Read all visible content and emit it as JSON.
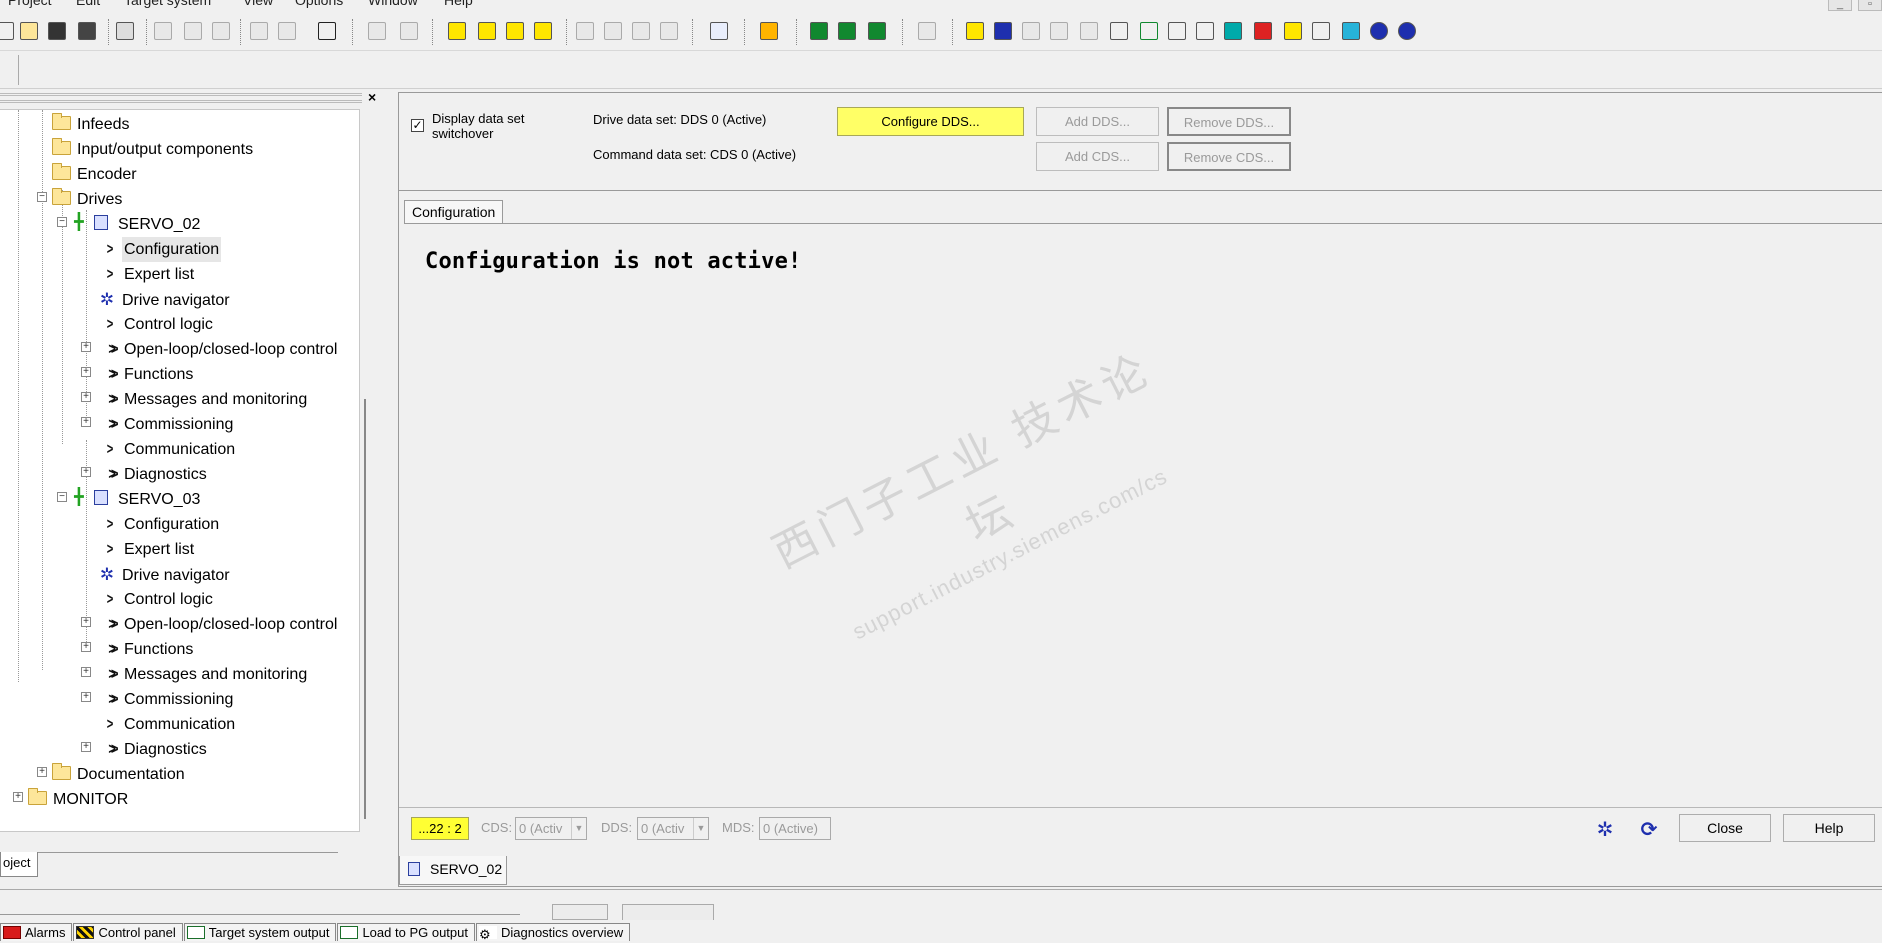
{
  "menu": [
    "Project",
    "Edit",
    "Target system",
    "View",
    "Options",
    "Window",
    "Help"
  ],
  "tree": {
    "nodes": [
      {
        "label": "Infeeds",
        "icon": "folder"
      },
      {
        "label": "Input/output components",
        "icon": "folder"
      },
      {
        "label": "Encoder",
        "icon": "folder"
      },
      {
        "label": "Drives",
        "icon": "folder"
      },
      {
        "label": "SERVO_02",
        "icon": "drive"
      },
      {
        "label": "Configuration",
        "icon": "chevron"
      },
      {
        "label": "Expert list",
        "icon": "chevron"
      },
      {
        "label": "Drive navigator",
        "icon": "navigator"
      },
      {
        "label": "Control logic",
        "icon": "chevron"
      },
      {
        "label": "Open-loop/closed-loop control",
        "icon": "double-chevron"
      },
      {
        "label": "Functions",
        "icon": "double-chevron"
      },
      {
        "label": "Messages and monitoring",
        "icon": "double-chevron"
      },
      {
        "label": "Commissioning",
        "icon": "double-chevron"
      },
      {
        "label": "Communication",
        "icon": "chevron"
      },
      {
        "label": "Diagnostics",
        "icon": "double-chevron"
      },
      {
        "label": "SERVO_03",
        "icon": "drive"
      },
      {
        "label": "Configuration",
        "icon": "chevron"
      },
      {
        "label": "Expert list",
        "icon": "chevron"
      },
      {
        "label": "Drive navigator",
        "icon": "navigator"
      },
      {
        "label": "Control logic",
        "icon": "chevron"
      },
      {
        "label": "Open-loop/closed-loop control",
        "icon": "double-chevron"
      },
      {
        "label": "Functions",
        "icon": "double-chevron"
      },
      {
        "label": "Messages and monitoring",
        "icon": "double-chevron"
      },
      {
        "label": "Commissioning",
        "icon": "double-chevron"
      },
      {
        "label": "Communication",
        "icon": "chevron"
      },
      {
        "label": "Diagnostics",
        "icon": "double-chevron"
      },
      {
        "label": "Documentation",
        "icon": "folder"
      },
      {
        "label": "MONITOR",
        "icon": "folder"
      }
    ],
    "project_tab": "oject",
    "close_glyph": "×"
  },
  "dds": {
    "checkbox_label": "Display data set switchover",
    "checkbox_checked": true,
    "checkmark": "✓",
    "drive_data_set": "Drive data set: DDS 0 (Active)",
    "command_data_set": "Command data set: CDS 0 (Active)",
    "configure_dds": "Configure DDS...",
    "add_dds": "Add DDS...",
    "remove_dds": "Remove DDS...",
    "add_cds": "Add CDS...",
    "remove_cds": "Remove CDS..."
  },
  "config": {
    "tab_label": "Configuration",
    "message": "Configuration is not active!"
  },
  "watermark": {
    "line1": "西门子工业 技术论坛",
    "line2": "support.industry.siemens.com/cs"
  },
  "status": {
    "position": "...22 : 2",
    "cds_label": "CDS:",
    "cds_value": "0 (Activ",
    "dds_label": "DDS:",
    "dds_value": "0 (Activ",
    "mds_label": "MDS:",
    "mds_value": "0 (Active)",
    "dropdown_arrow": "▼",
    "close_button": "Close",
    "help_button": "Help",
    "drive_tab": "SERVO_02"
  },
  "bottom_tabs": [
    {
      "label": "Alarms",
      "icon": "alarm-icon"
    },
    {
      "label": "Control panel",
      "icon": "control-panel-icon"
    },
    {
      "label": "Target system output",
      "icon": "table-icon"
    },
    {
      "label": "Load to PG output",
      "icon": "table-icon"
    },
    {
      "label": "Diagnostics overview",
      "icon": "diagnostics-icon"
    }
  ],
  "colors": {
    "highlight_yellow": "#ffff66",
    "status_yellow": "#ffff33",
    "icon_blue": "#1e2fae",
    "drive_green": "#22a322"
  }
}
